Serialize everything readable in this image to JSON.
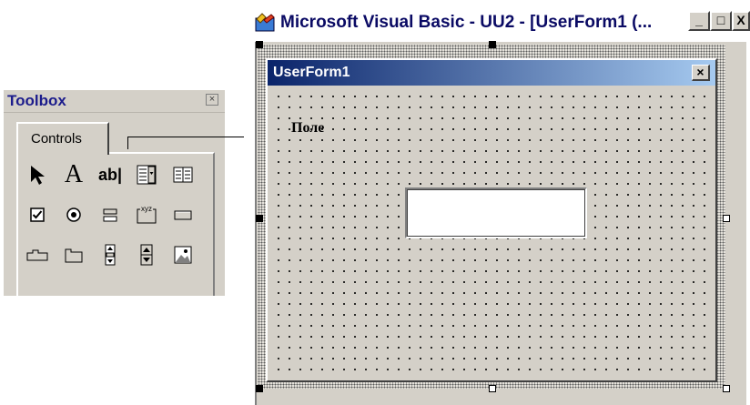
{
  "toolbox": {
    "title": "Toolbox",
    "close_glyph": "×",
    "tab_label": "Controls",
    "tools": [
      {
        "icon": "pointer-icon",
        "row": 0
      },
      {
        "icon": "label-icon",
        "text": "A",
        "row": 0
      },
      {
        "icon": "textbox-icon",
        "text": "ab|",
        "row": 0
      },
      {
        "icon": "combobox-icon",
        "row": 0
      },
      {
        "icon": "listbox-icon",
        "row": 0
      },
      {
        "icon": "checkbox-icon",
        "row": 1
      },
      {
        "icon": "optionbutton-icon",
        "row": 1
      },
      {
        "icon": "togglebutton-icon",
        "row": 1
      },
      {
        "icon": "frame-icon",
        "text": "xyz",
        "row": 1
      },
      {
        "icon": "commandbutton-icon",
        "row": 1
      },
      {
        "icon": "tabstrip-icon",
        "row": 2
      },
      {
        "icon": "multipage-icon",
        "row": 2
      },
      {
        "icon": "scrollbar-icon",
        "row": 2
      },
      {
        "icon": "spinbutton-icon",
        "row": 2
      },
      {
        "icon": "image-icon",
        "row": 2
      }
    ]
  },
  "callout": {
    "label": "Поле"
  },
  "vb_window": {
    "title": "Microsoft Visual Basic - UU2 - [UserForm1 (...",
    "minimize_glyph": "_",
    "maximize_glyph": "□",
    "close_glyph": "X"
  },
  "userform": {
    "title": "UserForm1",
    "close_glyph": "×",
    "textbox_value": ""
  },
  "colors": {
    "face": "#d4d0c8",
    "form_title_start": "#0a246a",
    "form_title_end": "#a6caf0",
    "toolbox_title": "#1c1c8c"
  }
}
